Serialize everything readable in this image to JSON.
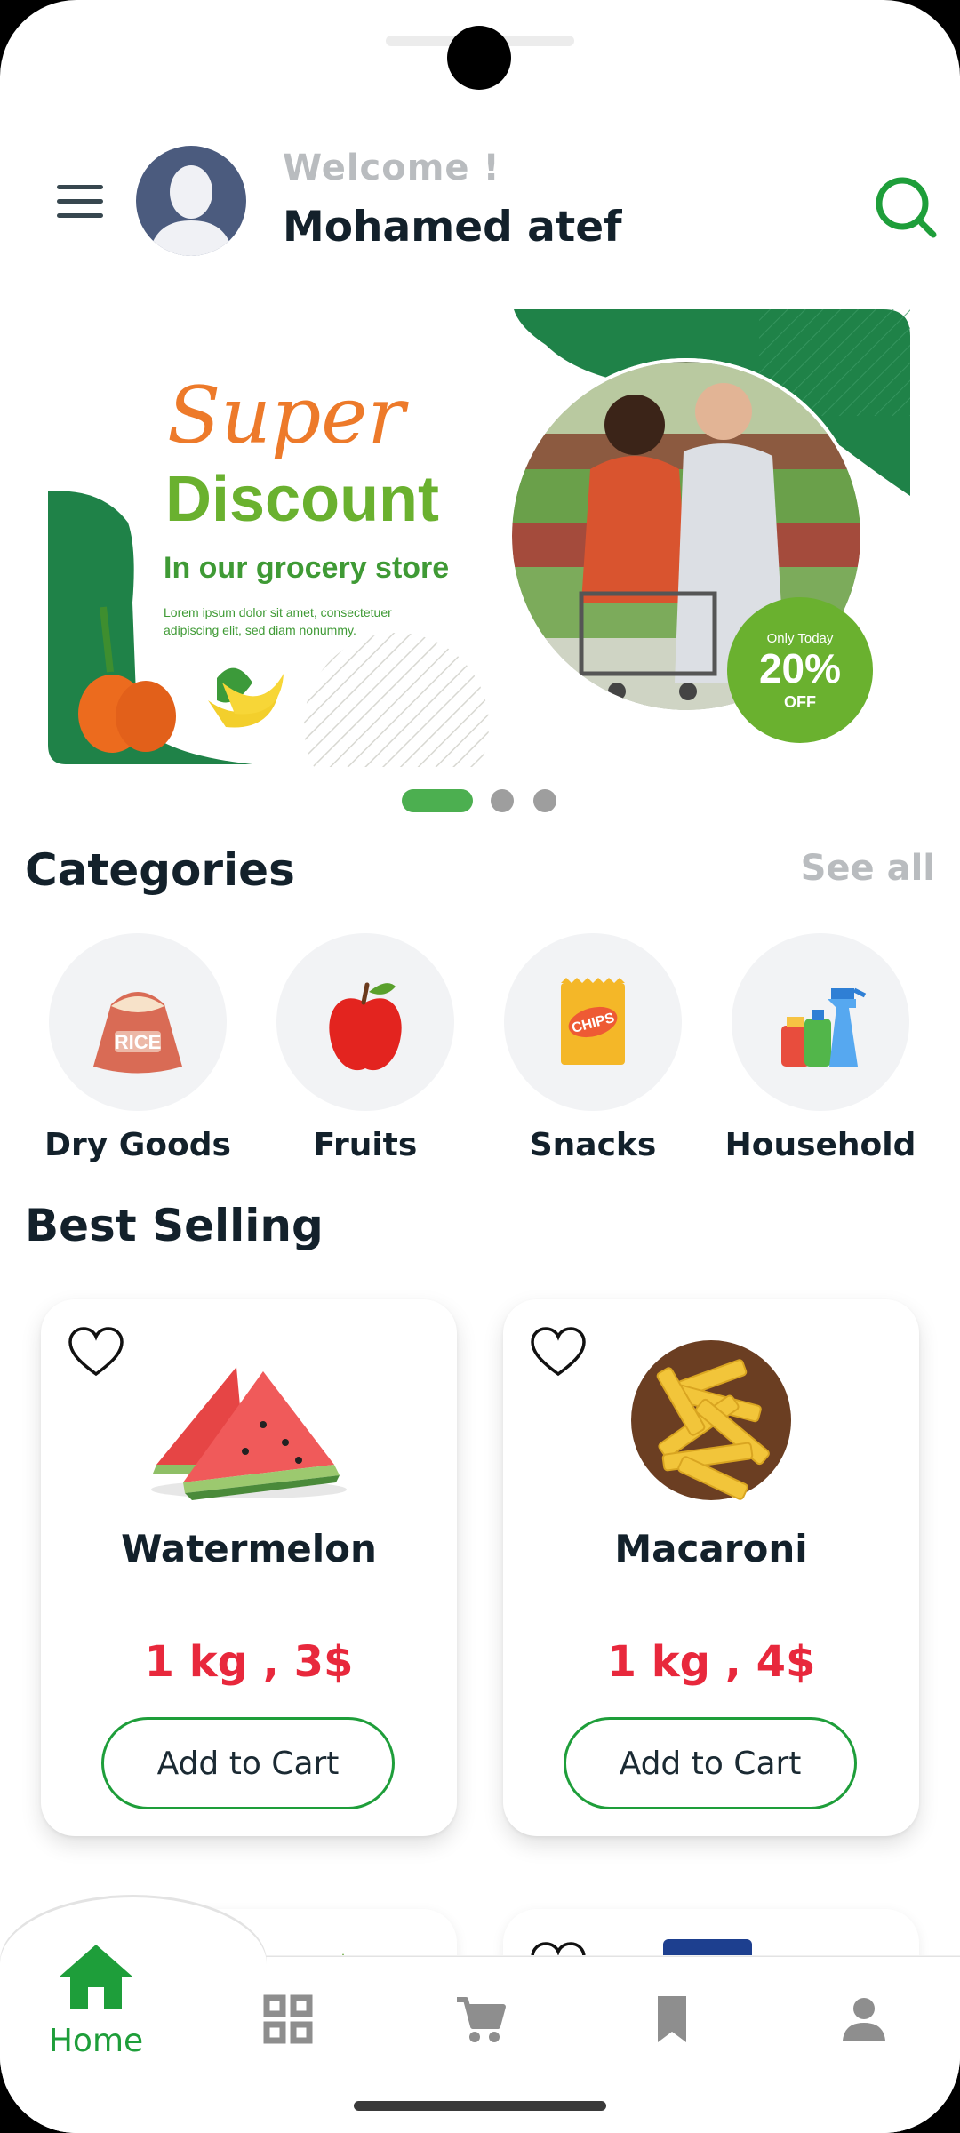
{
  "header": {
    "welcome_text": "Welcome !",
    "user_name": "Mohamed atef",
    "menu_icon": "hamburger-menu-icon",
    "search_icon": "search-icon"
  },
  "banner": {
    "title_line1": "Super",
    "title_line2": "Discount",
    "subtitle": "In our grocery store",
    "body_line1": "Lorem ipsum dolor sit amet, consectetuer",
    "body_line2": "adipiscing elit, sed diam nonummy.",
    "badge_top": "Only Today",
    "badge_value": "20%",
    "badge_bottom": "OFF",
    "slide_count": 3,
    "active_slide": 1
  },
  "categories": {
    "title": "Categories",
    "see_all": "See all",
    "items": [
      {
        "label": "Dry Goods",
        "icon": "rice-sack-icon",
        "icon_text": "RICE"
      },
      {
        "label": "Fruits",
        "icon": "apple-icon"
      },
      {
        "label": "Snacks",
        "icon": "chips-bag-icon",
        "icon_text": "CHIPS"
      },
      {
        "label": "Household",
        "icon": "cleaning-bottles-icon"
      }
    ]
  },
  "best_selling": {
    "title": "Best Selling",
    "products": [
      {
        "name": "Watermelon",
        "price": "1 kg ,  3$",
        "button": "Add to Cart",
        "favorite": false
      },
      {
        "name": "Macaroni",
        "price": "1 kg ,  4$",
        "button": "Add to Cart",
        "favorite": false
      }
    ]
  },
  "bottom_nav": {
    "active": "home",
    "items": [
      {
        "id": "home",
        "label": "Home",
        "icon": "home-icon"
      },
      {
        "id": "categories",
        "label": "",
        "icon": "grid-icon"
      },
      {
        "id": "cart",
        "label": "",
        "icon": "cart-icon"
      },
      {
        "id": "saved",
        "label": "",
        "icon": "bookmark-icon"
      },
      {
        "id": "profile",
        "label": "",
        "icon": "person-icon"
      }
    ]
  },
  "colors": {
    "accent_green": "#1e9e3a",
    "price_red": "#e8283c",
    "banner_green": "#1f8248",
    "banner_orange": "#ed7a2a"
  }
}
